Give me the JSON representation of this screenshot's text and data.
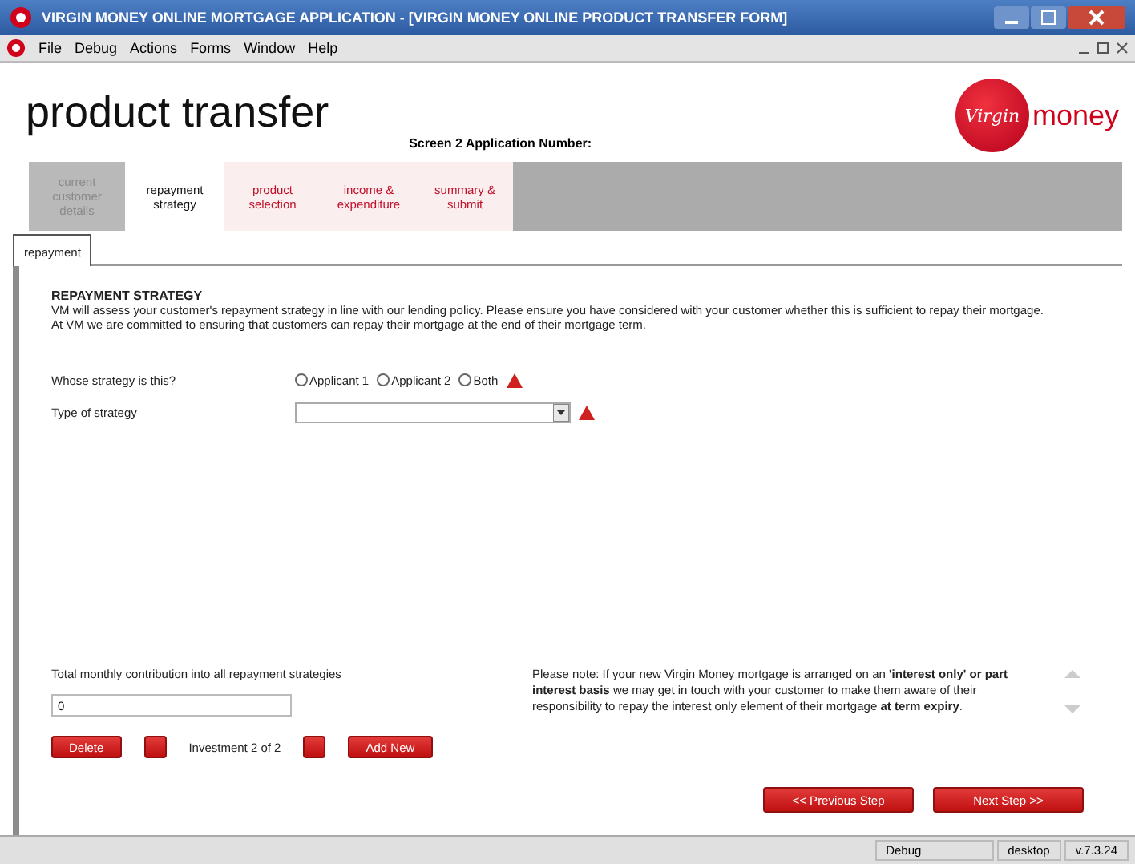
{
  "window": {
    "title": "VIRGIN MONEY ONLINE MORTGAGE APPLICATION - [VIRGIN MONEY ONLINE PRODUCT TRANSFER FORM]"
  },
  "menu": [
    "File",
    "Debug",
    "Actions",
    "Forms",
    "Window",
    "Help"
  ],
  "header": {
    "title": "product transfer",
    "screen_label": "Screen 2  Application Number:",
    "logo_script": "Virgin",
    "logo_word": "money"
  },
  "tabs": [
    {
      "label": "current customer details",
      "selected": false,
      "disabled": true
    },
    {
      "label": "repayment strategy",
      "selected": true,
      "disabled": false
    },
    {
      "label": "product selection",
      "selected": false,
      "disabled": false
    },
    {
      "label": "income & expenditure",
      "selected": false,
      "disabled": false
    },
    {
      "label": "summary & submit",
      "selected": false,
      "disabled": false
    }
  ],
  "subtabs": [
    {
      "label": "repayment",
      "selected": true
    }
  ],
  "section": {
    "heading": "REPAYMENT STRATEGY",
    "paragraphs": [
      "VM will assess your customer's repayment strategy in line with our lending policy. Please ensure you have considered with your customer whether this is sufficient to repay their mortgage.",
      "At VM we are committed to ensuring that customers can repay their mortgage at the end of their mortgage term."
    ]
  },
  "fields": [
    {
      "kind": "radio",
      "label": "Whose strategy is this?",
      "required": true,
      "options": [
        {
          "label": "Applicant 1",
          "selected": false
        },
        {
          "label": "Applicant 2",
          "selected": false
        },
        {
          "label": "Both",
          "selected": false
        }
      ]
    },
    {
      "kind": "select",
      "label": "Type of strategy",
      "required": true
    }
  ],
  "total": {
    "label": "Total monthly contribution into all repayment strategies",
    "value": "0"
  },
  "note": "Please note: If your new Virgin Money mortgage is arranged on an **'interest only' or part interest basis** we may get in touch with your customer to make them aware of their responsibility to repay the interest only element of their mortgage **at term expiry**.",
  "record_nav": {
    "delete": "Delete",
    "counter": "Investment 2 of 2",
    "add": "Add New"
  },
  "steps": {
    "previous": "<< Previous Step",
    "next": "Next Step >>"
  },
  "status_bar": [
    "Debug",
    "desktop",
    "v.7.3.24"
  ]
}
